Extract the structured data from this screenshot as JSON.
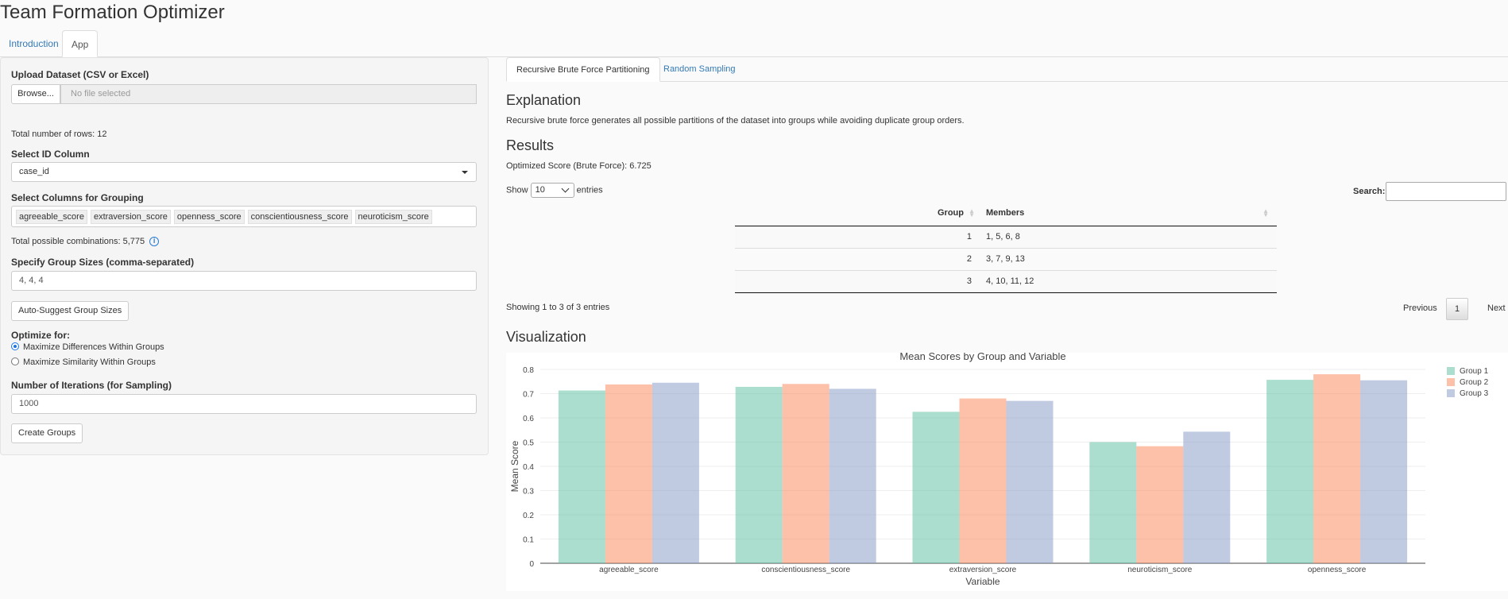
{
  "app": {
    "title": "Team Formation Optimizer"
  },
  "top_tabs": [
    {
      "label": "Introduction"
    },
    {
      "label": "App"
    }
  ],
  "sidebar": {
    "upload_label": "Upload Dataset (CSV or Excel)",
    "browse_label": "Browse...",
    "file_placeholder": "No file selected",
    "total_rows": "Total number of rows: 12",
    "id_column_label": "Select ID Column",
    "id_column_value": "case_id",
    "grouping_label": "Select Columns for Grouping",
    "grouping_columns": [
      "agreeable_score",
      "extraversion_score",
      "openness_score",
      "conscientiousness_score",
      "neuroticism_score"
    ],
    "combinations": "Total possible combinations: 5,775",
    "info_icon": "i",
    "group_sizes_label": "Specify Group Sizes (comma-separated)",
    "group_sizes_value": "4, 4, 4",
    "auto_suggest_label": "Auto-Suggest Group Sizes",
    "optimize_label": "Optimize for:",
    "optimize_options": [
      {
        "label": "Maximize Differences Within Groups",
        "selected": true
      },
      {
        "label": "Maximize Similarity Within Groups",
        "selected": false
      }
    ],
    "iterations_label": "Number of Iterations (for Sampling)",
    "iterations_value": "1000",
    "create_groups_label": "Create Groups"
  },
  "main": {
    "tabs": [
      {
        "label": "Recursive Brute Force Partitioning"
      },
      {
        "label": "Random Sampling"
      }
    ],
    "explanation_title": "Explanation",
    "explanation_text": "Recursive brute force generates all possible partitions of the dataset into groups while avoiding duplicate group orders.",
    "results_title": "Results",
    "optimized_score": "Optimized Score (Brute Force): 6.725",
    "show_label": "Show",
    "show_value": "10",
    "entries_label": "entries",
    "search_label": "Search:",
    "table": {
      "columns": [
        "Group",
        "Members"
      ],
      "rows": [
        {
          "group": "1",
          "members": "1, 5, 6, 8"
        },
        {
          "group": "2",
          "members": "3, 7, 9, 13"
        },
        {
          "group": "3",
          "members": "4, 10, 11, 12"
        }
      ]
    },
    "showing_text": "Showing 1 to 3 of 3 entries",
    "previous_label": "Previous",
    "page_label": "1",
    "next_label": "Next",
    "visualization_title": "Visualization"
  },
  "chart_data": {
    "type": "bar",
    "title": "Mean Scores by Group and Variable",
    "xlabel": "Variable",
    "ylabel": "Mean Score",
    "ylim": [
      0,
      0.8
    ],
    "yticks": [
      "0",
      "0.1",
      "0.2",
      "0.3",
      "0.4",
      "0.5",
      "0.6",
      "0.7",
      "0.8"
    ],
    "categories": [
      "agreeable_score",
      "conscientiousness_score",
      "extraversion_score",
      "neuroticism_score",
      "openness_score"
    ],
    "series": [
      {
        "name": "Group 1",
        "color": "#66c2a5",
        "values": [
          0.713,
          0.728,
          0.625,
          0.5,
          0.757
        ]
      },
      {
        "name": "Group 2",
        "color": "#fc8d62",
        "values": [
          0.738,
          0.74,
          0.68,
          0.483,
          0.78
        ]
      },
      {
        "name": "Group 3",
        "color": "#8da0cb",
        "values": [
          0.745,
          0.72,
          0.67,
          0.543,
          0.755
        ]
      }
    ],
    "legend_position": "top-right",
    "grid": true
  }
}
